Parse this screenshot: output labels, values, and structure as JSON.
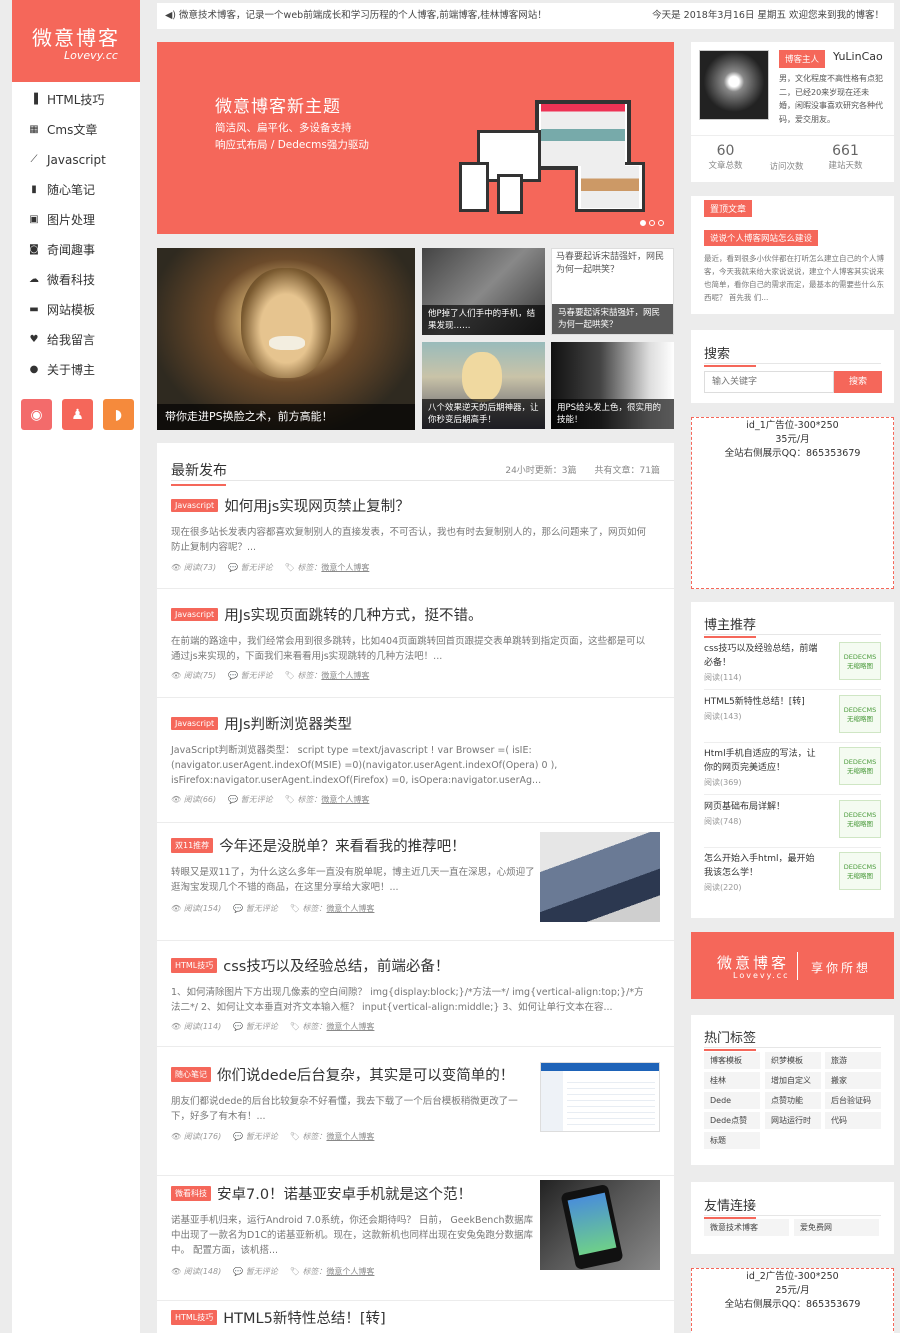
{
  "brand": {
    "title": "微意博客",
    "subtitle": "Lovevy.cc"
  },
  "nav": [
    {
      "label": "HTML技巧",
      "icon": "document-icon"
    },
    {
      "label": "Cms文章",
      "icon": "grid-icon"
    },
    {
      "label": "Javascript",
      "icon": "leaf-icon"
    },
    {
      "label": "随心笔记",
      "icon": "notebook-icon"
    },
    {
      "label": "图片处理",
      "icon": "picture-icon"
    },
    {
      "label": "奇闻趣事",
      "icon": "camera-icon"
    },
    {
      "label": "微看科技",
      "icon": "cloud-icon"
    },
    {
      "label": "网站模板",
      "icon": "template-icon"
    },
    {
      "label": "给我留言",
      "icon": "heart-icon"
    },
    {
      "label": "关于博主",
      "icon": "user-icon"
    }
  ],
  "topbar": {
    "notice": "微意技术博客，记录一个web前端成长和学习历程的个人博客,前端博客,桂林博客网站！",
    "today": "今天是 2018年3月16日 星期五 欢迎您来到我的博客！"
  },
  "banner": {
    "title": "微意博客新主题",
    "line1": "简洁风、扁平化、多设备支持",
    "line2": "响应式布局 / Dedecms强力驱动"
  },
  "photos": {
    "p1": "带你走进PS换脸之术，前方高能！",
    "p2": "他P掉了人们手中的手机，结果发现……",
    "p3": "马春要起诉宋喆强奸，网民为何一起哄笑？",
    "p3_alt": "马春要起诉宋喆强奸，网民为何一起哄笑？",
    "p4": "八个效果逆天的后期神器，让你秒变后期高手！",
    "p5": "用PS给头发上色，很实用的技能！"
  },
  "main": {
    "heading": "最新发布",
    "stats": "24小时更新：3篇　　共有文章：71篇",
    "articles": [
      {
        "tag": "Javascript",
        "title": "如何用js实现网页禁止复制？",
        "desc": "现在很多站长发表内容都喜欢复制别人的直接发表，不可否认，我也有时去复制别人的，那么问题来了，网页如何防止复制内容呢？...",
        "read": "阅读(73)",
        "comment": "暂无评论",
        "label": "标签：",
        "tagtext": "微意个人博客"
      },
      {
        "tag": "Javascript",
        "title": "用Js实现页面跳转的几种方式，挺不错。",
        "desc": "在前端的路途中，我们经常会用到很多跳转，比如404页面跳转回首页跟提交表单跳转到指定页面，这些都是可以通过js来实现的，下面我们来看看用js实现跳转的几种方法吧！...",
        "read": "阅读(75)",
        "comment": "暂无评论",
        "label": "标签：",
        "tagtext": "微意个人博客"
      },
      {
        "tag": "Javascript",
        "title": "用Js判断浏览器类型",
        "desc": "JavaScript判断浏览器类型： script type =text/javascript ! var Browser =( isIE:(navigator.userAgent.indexOf(MSIE) =0)(navigator.userAgent.indexOf(Opera) 0 ), isFirefox:navigator.userAgent.indexOf(Firefox) =0, isOpera:navigator.userAg...",
        "read": "阅读(66)",
        "comment": "暂无评论",
        "label": "标签：",
        "tagtext": "微意个人博客"
      },
      {
        "tag": "双11推荐",
        "title": "今年还是没脱单？来看看我的推荐吧！",
        "desc": "转眼又是双11了，为什么这么多年一直没有脱单呢，博主近几天一直在深思，心烦迎了逛淘宝发现几个不错的商品，在这里分享给大家吧！...",
        "read": "阅读(154)",
        "comment": "暂无评论",
        "label": "标签：",
        "tagtext": "微意个人博客"
      },
      {
        "tag": "HTML技巧",
        "title": "css技巧以及经验总结，前端必备！",
        "desc": "1、如何清除图片下方出现几像素的空白间隙？ img{display:block;}/*方法一*/ img{vertical-align:top;}/*方法二*/ 2、如何让文本垂直对齐文本输入框？ input{vertical-align:middle;} 3、如何让单行文本在容...",
        "read": "阅读(114)",
        "comment": "暂无评论",
        "label": "标签：",
        "tagtext": "微意个人博客"
      },
      {
        "tag": "随心笔记",
        "title": "你们说dede后台复杂，其实是可以变简单的！",
        "desc": "朋友们都说dede的后台比较复杂不好看懂，我去下载了一个后台模板稍微更改了一下，好多了有木有！...",
        "read": "阅读(176)",
        "comment": "暂无评论",
        "label": "标签：",
        "tagtext": "微意个人博客"
      },
      {
        "tag": "微看科技",
        "title": "安卓7.0！诺基亚安卓手机就是这个范！",
        "desc": "诺基亚手机归来，运行Android 7.0系统，你还会期待吗？ 日前， GeekBench数据库中出现了一款名为D1C的诺基亚新机。现在，这款新机也同样出现在安兔兔跑分数据库中。 配置方面，该机搭...",
        "read": "阅读(148)",
        "comment": "暂无评论",
        "label": "标签：",
        "tagtext": "微意个人博客"
      },
      {
        "tag": "HTML技巧",
        "title": "HTML5新特性总结！[转]"
      }
    ]
  },
  "profile": {
    "badge": "博客主人",
    "name": "YuLinCao",
    "bio": "男，文化程度不高性格有点犯二，已经20来岁现在还未婚，闲暇没事喜欢研究各种代码，爱交朋友。",
    "stats": [
      {
        "num": "60",
        "label": "文章总数"
      },
      {
        "num": "",
        "label": "访问次数"
      },
      {
        "num": "661",
        "label": "建站天数"
      }
    ]
  },
  "top_article": {
    "badge": "置顶文章",
    "title": "说说个人博客网站怎么建设",
    "desc": "最近，看到很多小伙伴都在打听怎么建立自己的个人博客，今天我就来给大家说说说，建立个人博客其实说来也简单，看你自己的需求而定，最基本的需要些什么东西呢？ 首先我 们..."
  },
  "search": {
    "title": "搜索",
    "placeholder": "输入关键字",
    "button": "搜索"
  },
  "ad1": {
    "l1": "id_1广告位-300*250",
    "l2": "35元/月",
    "l3": "全站右侧展示QQ：865353679"
  },
  "recommend": {
    "title": "博主推荐",
    "thumb": "DEDECMS 无缩略图",
    "items": [
      {
        "title": "css技巧以及经验总结，前端必备！",
        "read": "阅读(114)"
      },
      {
        "title": "HTML5新特性总结！[转]",
        "read": "阅读(143)"
      },
      {
        "title": "Html手机自适应的写法，让你的网页完美适应！",
        "read": "阅读(369)"
      },
      {
        "title": "网页基础布局详解！",
        "read": "阅读(748)"
      },
      {
        "title": "怎么开始入手html，最开始我该怎么学！",
        "read": "阅读(220)"
      }
    ]
  },
  "promo": {
    "title": "微意博客",
    "sub": "Lovevy.cc",
    "slogan": "享你所想"
  },
  "hot_tags": {
    "title": "热门标签",
    "tags": [
      "博客模板",
      "织梦模板",
      "旅游",
      "桂林",
      "增加自定义",
      "搬家",
      "Dede",
      "点赞功能",
      "后台验证码",
      "Dede点赞",
      "网站运行时",
      "代码",
      "标题"
    ]
  },
  "links": {
    "title": "友情连接",
    "items": [
      "微意技术博客",
      "爱免费网"
    ]
  },
  "ad2": {
    "l1": "id_2广告位-300*250",
    "l2": "25元/月",
    "l3": "全站右侧展示QQ：865353679"
  },
  "colors": {
    "accent": "#f5675a",
    "weibo": "#f36b6b",
    "qq": "#f5675a",
    "rss": "#f58a3c"
  }
}
